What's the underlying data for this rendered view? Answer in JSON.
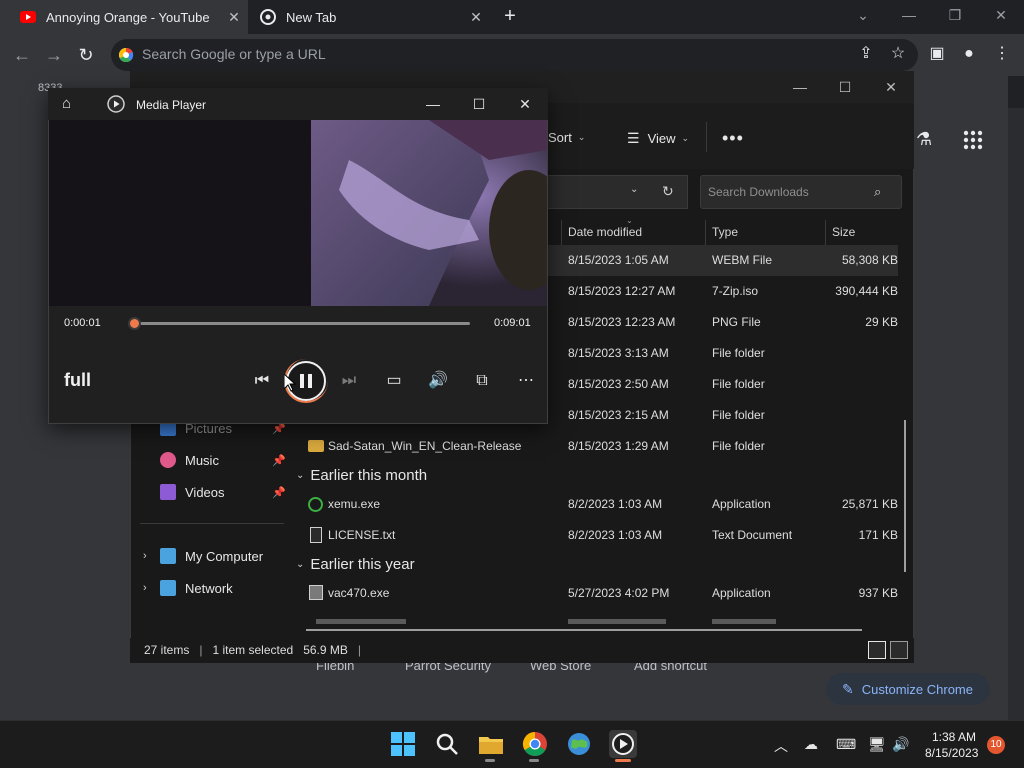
{
  "chrome": {
    "tabs": [
      {
        "title": "Annoying Orange - YouTube",
        "favicon": "youtube-icon",
        "active": true
      },
      {
        "title": "New Tab",
        "favicon": "chrome-icon",
        "active": false
      }
    ],
    "omnibox_placeholder": "Search Google or type a URL",
    "background_text": "8333",
    "shortcuts": [
      "Filebin",
      "Parrot Security",
      "Web Store",
      "Add shortcut"
    ],
    "customize_label": "Customize Chrome",
    "theme_bg": "#35363a",
    "accent": "#8ab4f8"
  },
  "explorer": {
    "commands": {
      "sort": "Sort",
      "view": "View"
    },
    "search_placeholder": "Search Downloads",
    "columns": {
      "date": "Date modified",
      "type": "Type",
      "size": "Size"
    },
    "rows_top": [
      {
        "date": "8/15/2023 1:05 AM",
        "type": "WEBM File",
        "size": "58,308 KB",
        "selected": true
      },
      {
        "date": "8/15/2023 12:27 AM",
        "type": "7-Zip.iso",
        "size": "390,444 KB"
      },
      {
        "date": "8/15/2023 12:23 AM",
        "type": "PNG File",
        "size": "29 KB"
      },
      {
        "date": "8/15/2023 3:13 AM",
        "type": "File folder",
        "size": ""
      },
      {
        "date": "8/15/2023 2:50 AM",
        "type": "File folder",
        "size": ""
      },
      {
        "date": "8/15/2023 2:15 AM",
        "type": "File folder",
        "size": ""
      }
    ],
    "folder_row": {
      "name": "Sad-Satan_Win_EN_Clean-Release",
      "date": "8/15/2023 1:29 AM",
      "type": "File folder",
      "size": ""
    },
    "groups": [
      {
        "title": "Earlier this month",
        "rows": [
          {
            "name": "xemu.exe",
            "date": "8/2/2023 1:03 AM",
            "type": "Application",
            "size": "25,871 KB",
            "icon": "xemu-icon"
          },
          {
            "name": "LICENSE.txt",
            "date": "8/2/2023 1:03 AM",
            "type": "Text Document",
            "size": "171 KB",
            "icon": "text-file-icon"
          }
        ]
      },
      {
        "title": "Earlier this year",
        "rows": [
          {
            "name": "vac470.exe",
            "date": "5/27/2023 4:02 PM",
            "type": "Application",
            "size": "937 KB",
            "icon": "installer-icon"
          }
        ]
      }
    ],
    "nav": {
      "pinned": [
        {
          "label": "Pictures",
          "icon": "pictures-icon"
        },
        {
          "label": "Music",
          "icon": "music-icon"
        },
        {
          "label": "Videos",
          "icon": "videos-icon"
        }
      ],
      "locations": [
        {
          "label": "My Computer",
          "icon": "computer-icon"
        },
        {
          "label": "Network",
          "icon": "network-icon"
        }
      ]
    },
    "status": {
      "items": "27 items",
      "selected": "1 item selected",
      "size": "56.9 MB"
    }
  },
  "media_player": {
    "title": "Media Player",
    "time_current": "0:00:01",
    "time_total": "0:09:01",
    "progress": 0.002,
    "caption": "full",
    "accent": "#ef7b4c"
  },
  "taskbar": {
    "apps": [
      "windows-start-icon",
      "search-icon",
      "file-explorer-icon",
      "chrome-icon",
      "globe-app-icon",
      "media-player-icon"
    ],
    "time": "1:38 AM",
    "date": "8/15/2023",
    "notifications": "10"
  }
}
